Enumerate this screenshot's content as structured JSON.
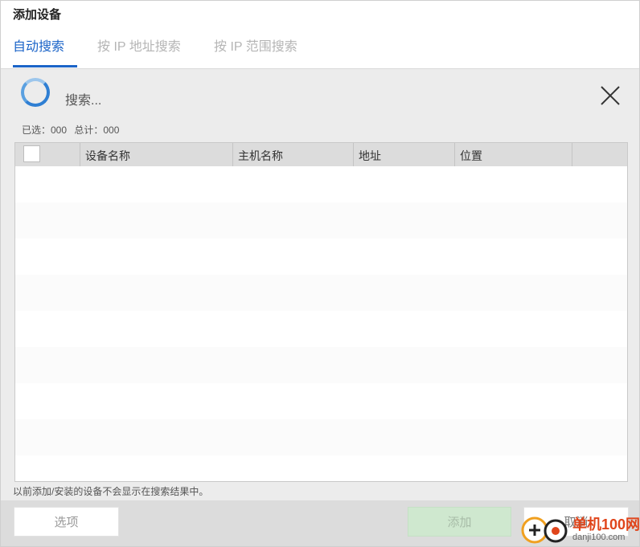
{
  "dialog": {
    "title": "添加设备"
  },
  "tabs": [
    {
      "label": "自动搜索",
      "active": true
    },
    {
      "label": "按 IP 地址搜索",
      "active": false
    },
    {
      "label": "按 IP 范围搜索",
      "active": false
    }
  ],
  "search": {
    "status_text": "搜索..."
  },
  "counts": {
    "selected": "已选：000",
    "total": "总计：000"
  },
  "table": {
    "columns": [
      "设备名称",
      "主机名称",
      "地址",
      "位置"
    ],
    "rows": []
  },
  "note": "以前添加/安装的设备不会显示在搜索结果中。",
  "footer": {
    "options_label": "选项",
    "add_label": "添加",
    "cancel_label": "取消"
  },
  "watermark": {
    "text": "单机100网",
    "url": "danji100.com"
  },
  "colors": {
    "accent": "#1b64c8",
    "panel_bg": "#ececec",
    "add_button_bg": "#cfe8cf",
    "watermark": "#e0451b"
  },
  "icons": {
    "spinner": "loading-spinner-icon",
    "close": "close-icon",
    "checkbox": "checkbox-icon"
  }
}
